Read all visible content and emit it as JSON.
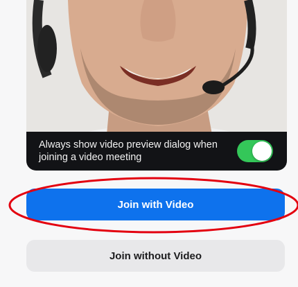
{
  "preview": {
    "overlay_text": "Always show video preview dialog when joining a video meeting",
    "toggle_on": true,
    "toggle_color": "#34c759"
  },
  "buttons": {
    "join_with_video": "Join with Video",
    "join_without_video": "Join without Video"
  },
  "colors": {
    "primary": "#0e72ed",
    "secondary": "#e8e8ea",
    "highlight": "#e3000f"
  }
}
